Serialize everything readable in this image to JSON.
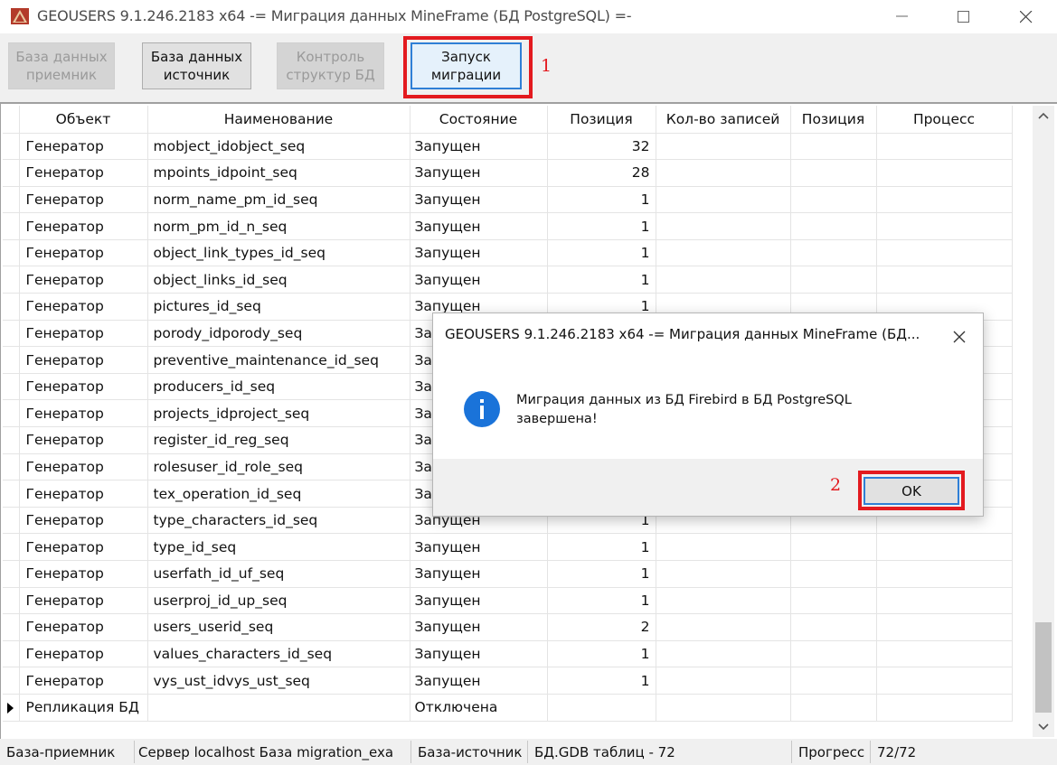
{
  "window": {
    "title": "GEOUSERS 9.1.246.2183 x64  -=  Миграция данных MineFrame (БД PostgreSQL) =-"
  },
  "toolbar": {
    "btn_target": "База данных\nприемник",
    "btn_source": "База данных\nисточник",
    "btn_control": "Контроль\nструктур БД",
    "btn_start": "Запуск\nмиграции",
    "marker1": "1"
  },
  "grid": {
    "headers": [
      "Объект",
      "Наименование",
      "Состояние",
      "Позиция",
      "Кол-во записей",
      "Позиция",
      "Процесс"
    ],
    "rows": [
      {
        "obj": "Генератор",
        "name": "mobject_idobject_seq",
        "state": "Запущен",
        "pos": "32"
      },
      {
        "obj": "Генератор",
        "name": "mpoints_idpoint_seq",
        "state": "Запущен",
        "pos": "28"
      },
      {
        "obj": "Генератор",
        "name": "norm_name_pm_id_seq",
        "state": "Запущен",
        "pos": "1"
      },
      {
        "obj": "Генератор",
        "name": "norm_pm_id_n_seq",
        "state": "Запущен",
        "pos": "1"
      },
      {
        "obj": "Генератор",
        "name": "object_link_types_id_seq",
        "state": "Запущен",
        "pos": "1"
      },
      {
        "obj": "Генератор",
        "name": "object_links_id_seq",
        "state": "Запущен",
        "pos": "1"
      },
      {
        "obj": "Генератор",
        "name": "pictures_id_seq",
        "state": "Запущен",
        "pos": "1"
      },
      {
        "obj": "Генератор",
        "name": "porody_idporody_seq",
        "state": "За",
        "pos": ""
      },
      {
        "obj": "Генератор",
        "name": "preventive_maintenance_id_seq",
        "state": "За",
        "pos": ""
      },
      {
        "obj": "Генератор",
        "name": "producers_id_seq",
        "state": "За",
        "pos": ""
      },
      {
        "obj": "Генератор",
        "name": "projects_idproject_seq",
        "state": "За",
        "pos": ""
      },
      {
        "obj": "Генератор",
        "name": "register_id_reg_seq",
        "state": "За",
        "pos": ""
      },
      {
        "obj": "Генератор",
        "name": "rolesuser_id_role_seq",
        "state": "За",
        "pos": ""
      },
      {
        "obj": "Генератор",
        "name": "tex_operation_id_seq",
        "state": "За",
        "pos": ""
      },
      {
        "obj": "Генератор",
        "name": "type_characters_id_seq",
        "state": "Запущен",
        "pos": "1"
      },
      {
        "obj": "Генератор",
        "name": "type_id_seq",
        "state": "Запущен",
        "pos": "1"
      },
      {
        "obj": "Генератор",
        "name": "userfath_id_uf_seq",
        "state": "Запущен",
        "pos": "1"
      },
      {
        "obj": "Генератор",
        "name": "userproj_id_up_seq",
        "state": "Запущен",
        "pos": "1"
      },
      {
        "obj": "Генератор",
        "name": "users_userid_seq",
        "state": "Запущен",
        "pos": "2"
      },
      {
        "obj": "Генератор",
        "name": "values_characters_id_seq",
        "state": "Запущен",
        "pos": "1"
      },
      {
        "obj": "Генератор",
        "name": "vys_ust_idvys_ust_seq",
        "state": "Запущен",
        "pos": "1"
      },
      {
        "obj": "Репликация БД",
        "name": "",
        "state": "Отключена",
        "pos": "",
        "current": true
      }
    ]
  },
  "statusbar": {
    "target_label": "База-приемник",
    "target_value": "Сервер localhost База migration_exa",
    "source_label": "База-источник",
    "source_value": "БД.GDB таблиц - 72",
    "progress_label": "Прогресс",
    "progress_value": "72/72"
  },
  "dialog": {
    "title": "GEOUSERS 9.1.246.2183 x64  -=  Миграция данных MineFrame (БД...",
    "message": "Миграция данных из БД Firebird в БД PostgreSQL завершена!",
    "ok_label": "OK",
    "marker2": "2"
  },
  "colors": {
    "highlight": "#e31a1f",
    "focus_border": "#2f7fd6",
    "info_icon": "#1a73d9"
  },
  "icons": [
    "app-logo-icon",
    "minimize-icon",
    "maximize-icon",
    "close-icon",
    "info-icon",
    "scroll-up-icon",
    "scroll-down-icon",
    "row-indicator-icon"
  ]
}
